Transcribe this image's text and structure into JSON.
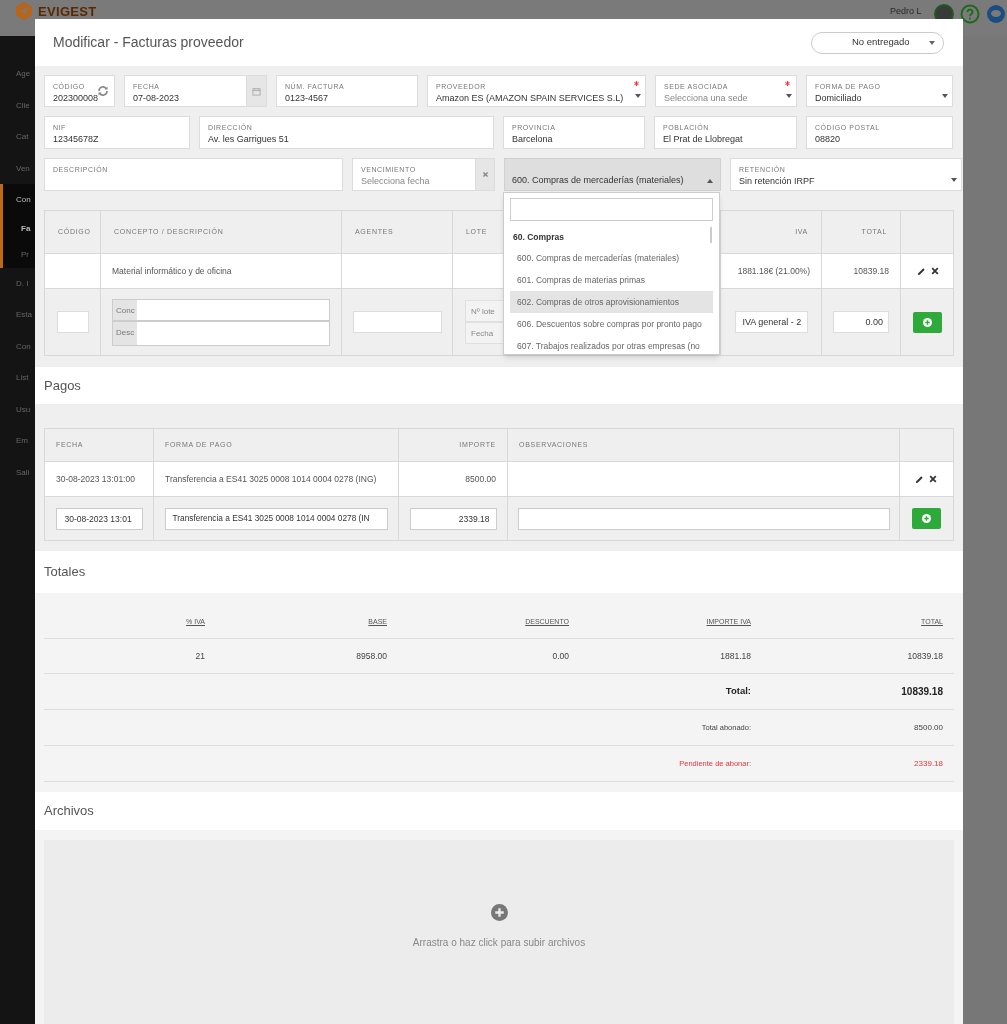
{
  "app": {
    "logo": "EVIGEST",
    "user": "Pedro L",
    "sidebar": [
      {
        "label": "Age",
        "selected": false
      },
      {
        "label": "Clie",
        "selected": false
      },
      {
        "label": "Cat",
        "selected": false
      },
      {
        "label": "Ven",
        "selected": false
      },
      {
        "label": "Con",
        "selected": true,
        "children": [
          {
            "label": "Fa",
            "selected": true
          },
          {
            "label": "Pr",
            "selected": false
          }
        ]
      },
      {
        "label": "D. I",
        "selected": false
      },
      {
        "label": "Esta",
        "selected": false
      },
      {
        "label": "Con",
        "selected": false
      },
      {
        "label": "List",
        "selected": false
      },
      {
        "label": "Usu",
        "selected": false
      },
      {
        "label": "Em",
        "selected": false
      },
      {
        "label": "Sali",
        "selected": false
      }
    ]
  },
  "modal": {
    "title": "Modificar - Facturas proveedor",
    "status": "No entregado",
    "field_rows": [
      [
        {
          "kind": "refresh",
          "label": "CÓDIGO",
          "value": "202300008"
        },
        {
          "kind": "date",
          "label": "FECHA",
          "value": "07-08-2023"
        },
        {
          "kind": "text",
          "label": "NÚM. FACTURA",
          "value": "0123-4567"
        },
        {
          "kind": "select",
          "label": "PROVEEDOR",
          "value": "Amazon ES (AMAZON SPAIN SERVICES S.L)",
          "required": true
        },
        {
          "kind": "select",
          "label": "SEDE ASOCIADA",
          "placeholder": "Selecciona una sede",
          "required": true
        },
        {
          "kind": "select",
          "label": "FORMA DE PAGO",
          "value": "Domiciliado"
        }
      ],
      [
        {
          "kind": "text",
          "label": "NIF",
          "value": "12345678Z"
        },
        {
          "kind": "text",
          "label": "DIRECCIÓN",
          "value": "Av. les Garrigues 51"
        },
        {
          "kind": "text",
          "label": "PROVINCIA",
          "value": "Barcelona"
        },
        {
          "kind": "text",
          "label": "POBLACIÓN",
          "value": "El Prat de Llobregat"
        },
        {
          "kind": "text",
          "label": "CÓDIGO POSTAL",
          "value": "08820"
        }
      ],
      [
        {
          "kind": "text",
          "label": "DESCRIPCIÓN"
        },
        {
          "kind": "clearable",
          "label": "VENCIMIENTO",
          "placeholder": "Selecciona fecha"
        },
        {
          "kind": "account",
          "value": "600. Compras de mercaderías (materiales)",
          "expanded": true
        },
        {
          "kind": "select",
          "label": "RETENCIÓN",
          "value": "Sin retención IRPF"
        }
      ]
    ],
    "account_dropdown": {
      "group": "60. Compras",
      "options": [
        {
          "label": "600. Compras de mercaderías (materiales)",
          "selected": false
        },
        {
          "label": "601. Compras de materias primas",
          "selected": false
        },
        {
          "label": "602. Compras de otros aprovisionamientos",
          "selected": true
        },
        {
          "label": "606. Descuentos sobre compras por pronto pago",
          "selected": false
        },
        {
          "label": "607. Trabajos realizados por otras empresas (no",
          "selected": false
        }
      ]
    },
    "lines": {
      "columns": [
        "CÓDIGO",
        "CONCEPTO / DESCRIPCIÓN",
        "AGENTES",
        "LOTE",
        "IVA",
        "TOTAL"
      ],
      "rows": [
        {
          "concept": "Material informático y de oficina",
          "iva": "1881.18€ (21.00%)",
          "total": "10839.18"
        }
      ],
      "new_row": {
        "concept_label": "Conc",
        "description_label": "Desc",
        "lot_placeholder": "Nº lote",
        "lot_date_placeholder": "Fecha",
        "iva": "IVA general - 2",
        "total": "0.00"
      }
    },
    "payments": {
      "title": "Pagos",
      "columns": [
        "FECHA",
        "FORMA DE PAGO",
        "IMPORTE",
        "OBSERVACIONES"
      ],
      "rows": [
        {
          "date": "30-08-2023 13:01:00",
          "method": "Transferencia a ES41 3025 0008 1014 0004 0278 (ING)",
          "amount": "8500.00"
        }
      ],
      "new_row": {
        "date": "30-08-2023 13:01",
        "method": "Transferencia a ES41 3025 0008 1014 0004 0278 (IN",
        "amount": "2339.18"
      }
    },
    "totals": {
      "title": "Totales",
      "columns": [
        "% IVA",
        "BASE",
        "DESCUENTO",
        "IMPORTE IVA",
        "TOTAL"
      ],
      "rows": [
        [
          "21",
          "8958.00",
          "0.00",
          "1881.18",
          "10839.18"
        ]
      ],
      "summary": [
        {
          "kind": "grand",
          "label": "Total:",
          "value": "10839.18"
        },
        {
          "kind": "normal",
          "label": "Total abonado:",
          "value": "8500.00"
        },
        {
          "kind": "due",
          "label": "Pendiente de abonar:",
          "value": "2339.18"
        }
      ]
    },
    "files": {
      "title": "Archivos",
      "hint": "Arrastra o haz click para subir archivos"
    }
  }
}
